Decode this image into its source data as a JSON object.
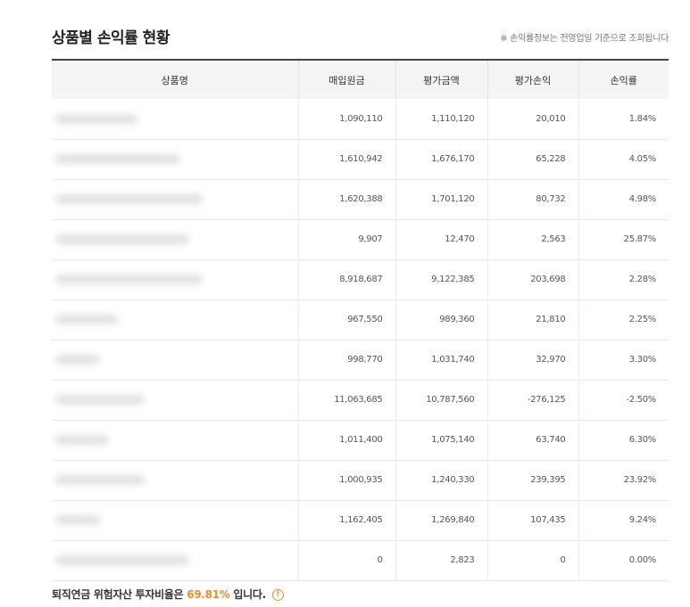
{
  "title": "상품별 손익률 현황",
  "note": "※ 손익률정보는 전영업일 기준으로 조회됩니다",
  "table": {
    "headers": [
      "상품명",
      "매입원금",
      "평가금액",
      "평가손익",
      "손익률"
    ],
    "rows": [
      {
        "principal": "1,090,110",
        "value": "1,110,120",
        "pnl": "20,010",
        "rate": "1.84%",
        "sign": "pos"
      },
      {
        "principal": "1,610,942",
        "value": "1,676,170",
        "pnl": "65,228",
        "rate": "4.05%",
        "sign": "pos"
      },
      {
        "principal": "1,620,388",
        "value": "1,701,120",
        "pnl": "80,732",
        "rate": "4.98%",
        "sign": "pos"
      },
      {
        "principal": "9,907",
        "value": "12,470",
        "pnl": "2,563",
        "rate": "25.87%",
        "sign": "pos"
      },
      {
        "principal": "8,918,687",
        "value": "9,122,385",
        "pnl": "203,698",
        "rate": "2.28%",
        "sign": "pos"
      },
      {
        "principal": "967,550",
        "value": "989,360",
        "pnl": "21,810",
        "rate": "2.25%",
        "sign": "pos"
      },
      {
        "principal": "998,770",
        "value": "1,031,740",
        "pnl": "32,970",
        "rate": "3.30%",
        "sign": "pos"
      },
      {
        "principal": "11,063,685",
        "value": "10,787,560",
        "pnl": "-276,125",
        "rate": "-2.50%",
        "sign": "neg"
      },
      {
        "principal": "1,011,400",
        "value": "1,075,140",
        "pnl": "63,740",
        "rate": "6.30%",
        "sign": "pos"
      },
      {
        "principal": "1,000,935",
        "value": "1,240,330",
        "pnl": "239,395",
        "rate": "23.92%",
        "sign": "pos"
      },
      {
        "principal": "1,162,405",
        "value": "1,269,840",
        "pnl": "107,435",
        "rate": "9.24%",
        "sign": "pos"
      },
      {
        "principal": "0",
        "value": "2,823",
        "pnl": "0",
        "rate": "0.00%",
        "sign": "zero"
      }
    ]
  },
  "footer": {
    "prefix": "퇴직연금 위험자산 투자비율은",
    "ratio": "69.81%",
    "suffix": "입니다.",
    "icon": "info-icon"
  },
  "colors": {
    "positive": "#ee3a1e",
    "negative": "#1e78c8",
    "highlight": "#f08c1e"
  }
}
